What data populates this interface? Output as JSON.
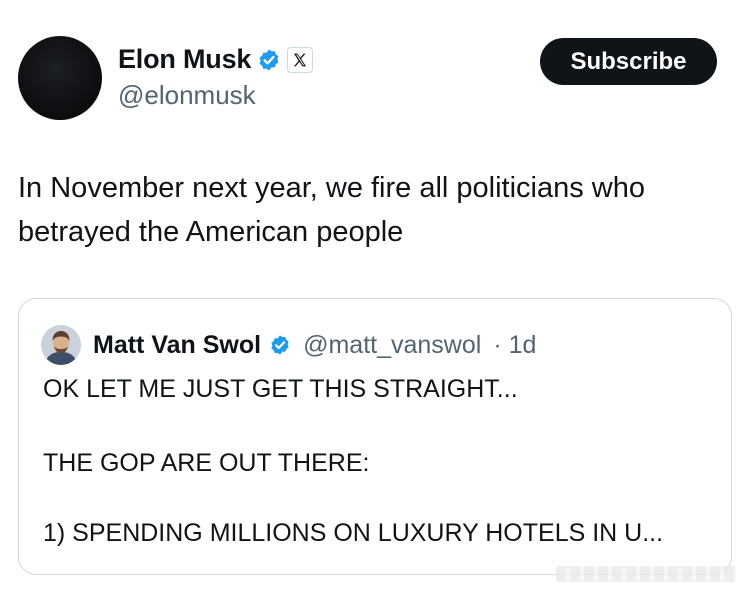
{
  "author": {
    "display_name": "Elon Musk",
    "handle": "@elonmusk",
    "verified": true,
    "affiliation_badge": "x-logo-icon"
  },
  "subscribe_label": "Subscribe",
  "tweet": {
    "text": "In November next year, we fire all politicians who betrayed the American people"
  },
  "quoted_tweet": {
    "display_name": "Matt Van Swol",
    "handle": "@matt_vanswol",
    "time": "· 1d",
    "lines": [
      "OK LET ME JUST GET THIS STRAIGHT...",
      "THE GOP ARE OUT THERE:",
      "1) SPENDING MILLIONS ON LUXURY HOTELS IN U..."
    ]
  },
  "colors": {
    "verified_blue": "#1d9bf0",
    "secondary_text": "#536471",
    "primary_text": "#0f1419",
    "border": "#cfd9de"
  }
}
